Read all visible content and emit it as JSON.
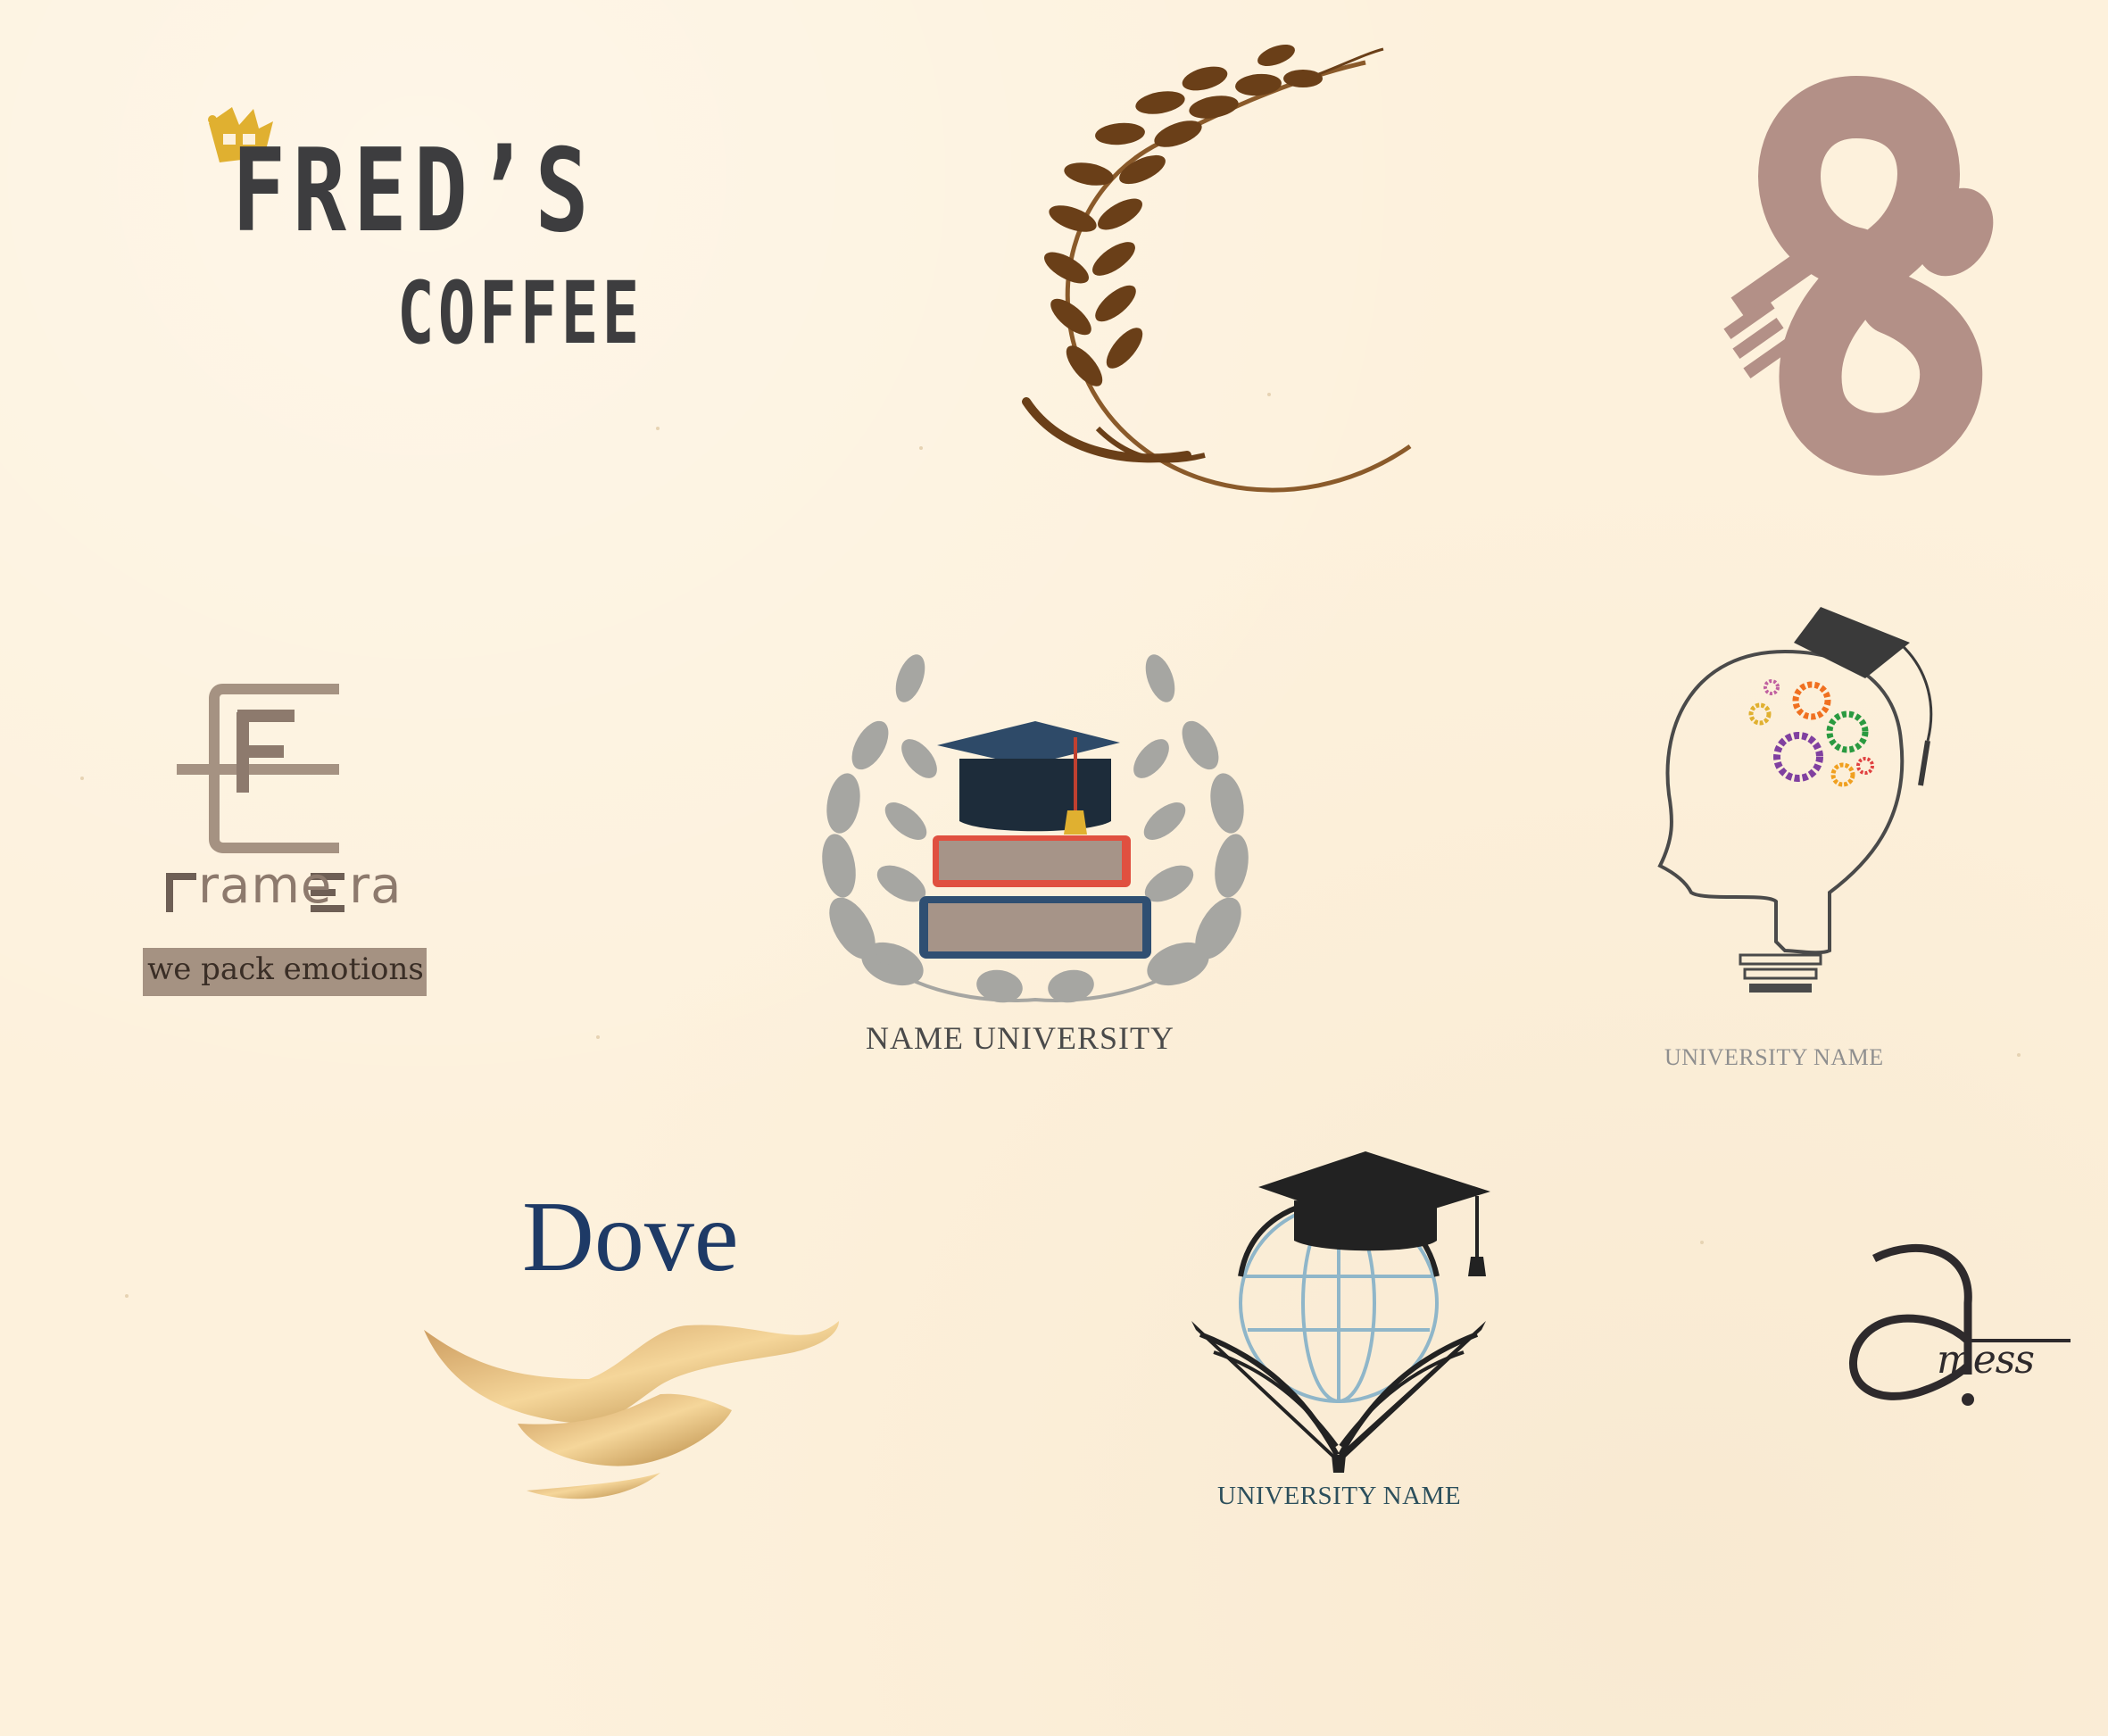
{
  "background_color": "#fdf1dc",
  "logos": {
    "freds_coffee": {
      "title": "FRED’S",
      "subtitle": "COFFEE",
      "icon": "crown-icon",
      "color": "#3d3d3f",
      "accent": "#e0b030"
    },
    "wheat_wreath": {
      "icon": "wheat-icon",
      "color": "#7a4a20"
    },
    "fork_spoon_infinity": {
      "icon": "fork-spoon-infinity-icon",
      "color": "#b39087"
    },
    "frame_era": {
      "name": "rame ra",
      "tagline": "we pack emotions",
      "icon": "fe-monogram-icon",
      "color": "#a59282"
    },
    "name_university": {
      "caption": "NAME UNIVERSITY",
      "icon": "books-graduation-cap-laurel-icon"
    },
    "bulb_university": {
      "caption": "UNIVERSITY NAME",
      "icon": "lightbulb-head-gears-icon"
    },
    "dove": {
      "word": "Dove",
      "icon": "bird-wings-icon",
      "color": "#1e3a66",
      "accent": "#d7b06a"
    },
    "globe_university": {
      "caption": "UNIVERSITY NAME",
      "icon": "globe-book-cap-icon"
    },
    "amess": {
      "word": "mess",
      "icon": "letter-a-icon",
      "color": "#2e2a2c"
    }
  }
}
